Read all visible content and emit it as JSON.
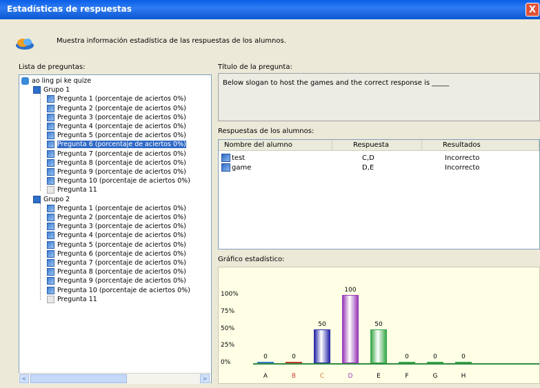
{
  "window": {
    "title": "Estadísticas de respuestas",
    "close_glyph": "X"
  },
  "header": {
    "description": "Muestra información estadística de las respuestas de los alumnos."
  },
  "left": {
    "label": "Lista de preguntas:",
    "root": "ao ling pi ke quize",
    "groups": [
      {
        "label": "Grupo 1",
        "items": [
          "Pregunta 1 (porcentaje de aciertos 0%)",
          "Pregunta 2 (porcentaje de aciertos 0%)",
          "Pregunta 3 (porcentaje de aciertos 0%)",
          "Pregunta 4 (porcentaje de aciertos 0%)",
          "Pregunta 5 (porcentaje de aciertos 0%)",
          "Pregunta 6 (porcentaje de aciertos 0%)",
          "Pregunta 7 (porcentaje de aciertos 0%)",
          "Pregunta 8 (porcentaje de aciertos 0%)",
          "Pregunta 9 (porcentaje de aciertos 0%)",
          "Pregunta 10 (porcentaje de aciertos 0%)",
          "Pregunta 11"
        ]
      },
      {
        "label": "Grupo 2",
        "items": [
          "Pregunta 1 (porcentaje de aciertos 0%)",
          "Pregunta 2 (porcentaje de aciertos 0%)",
          "Pregunta 3 (porcentaje de aciertos 0%)",
          "Pregunta 4 (porcentaje de aciertos 0%)",
          "Pregunta 5 (porcentaje de aciertos 0%)",
          "Pregunta 6 (porcentaje de aciertos 0%)",
          "Pregunta 7 (porcentaje de aciertos 0%)",
          "Pregunta 8 (porcentaje de aciertos 0%)",
          "Pregunta 9 (porcentaje de aciertos 0%)",
          "Pregunta 10 (porcentaje de aciertos 0%)",
          "Pregunta 11"
        ]
      }
    ],
    "selected": "Grupo 1 / Pregunta 6",
    "scroll_left": "<",
    "scroll_right": ">"
  },
  "question": {
    "label": "Título de la pregunta:",
    "text": "Below slogan to host the games and the correct response is _____"
  },
  "answers": {
    "label": "Respuestas de los alumnos:",
    "columns": [
      "Nombre del alumno",
      "Respuesta",
      "Resultados"
    ],
    "rows": [
      {
        "name": "test",
        "answer": "C,D",
        "result": "Incorrecto"
      },
      {
        "name": "game",
        "answer": "D,E",
        "result": "Incorrecto"
      }
    ]
  },
  "chart_label": "Gráfico estadístico:",
  "chart_data": {
    "type": "bar",
    "categories": [
      "A",
      "B",
      "C",
      "D",
      "E",
      "F",
      "G",
      "H"
    ],
    "values": [
      0,
      0,
      50,
      100,
      50,
      0,
      0,
      0
    ],
    "ytick_labels": [
      "100%",
      "75%",
      "50%",
      "25%",
      "0%"
    ],
    "ylim": [
      0,
      100
    ],
    "colors": [
      "#3a78c8",
      "#c83a2e",
      "#2a2aa8",
      "#9a3ab8",
      "#3aa84a",
      "#3aa84a",
      "#3aa84a",
      "#3aa84a"
    ],
    "label_colors": [
      "#000000",
      "#c83a2e",
      "#c87a2e",
      "#9a3ab8",
      "#000000",
      "#000000",
      "#000000",
      "#000000"
    ]
  }
}
